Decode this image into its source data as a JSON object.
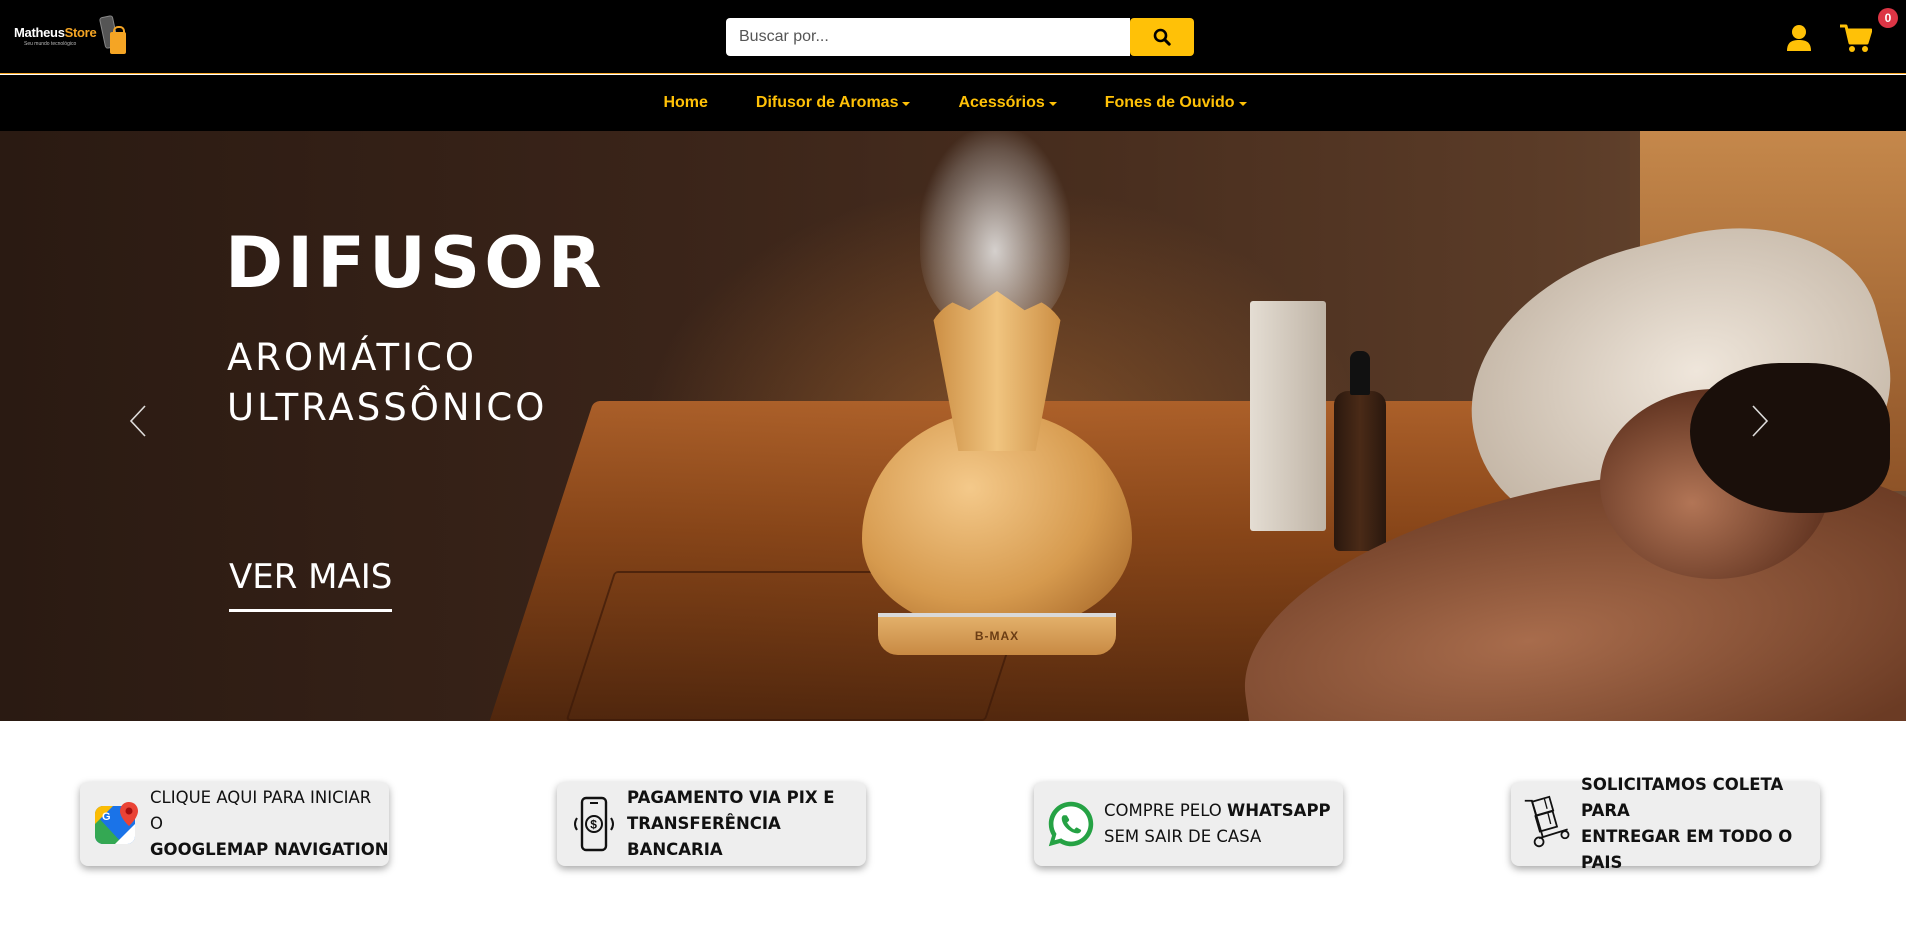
{
  "header": {
    "logo": {
      "name_part1": "Matheus",
      "name_part2": "Store",
      "tagline": "Seu mundo tecnológico"
    },
    "search": {
      "placeholder": "Buscar por...",
      "value": ""
    },
    "cart_count": "0",
    "accent_color": "#ffc107"
  },
  "nav": {
    "items": [
      {
        "label": "Home",
        "dropdown": false
      },
      {
        "label": "Difusor de Aromas",
        "dropdown": true
      },
      {
        "label": "Acessórios",
        "dropdown": true
      },
      {
        "label": "Fones de Ouvido",
        "dropdown": true
      }
    ]
  },
  "hero": {
    "title": "DIFUSOR",
    "subtitle": "AROMÁTICO ULTRASSÔNICO",
    "cta": "VER MAIS",
    "product_brand": "B-MAX"
  },
  "features": [
    {
      "icon": "google-maps-icon",
      "line1": "CLIQUE AQUI PARA INICIAR O",
      "line2": "GOOGLEMAP NAVIGATION"
    },
    {
      "icon": "pix-payment-icon",
      "line1": "PAGAMENTO VIA PIX E",
      "line2": "TRANSFERÊNCIA BANCARIA"
    },
    {
      "icon": "whatsapp-icon",
      "line1_a": "COMPRE PELO ",
      "line1_b": "WHATSAPP",
      "line2": "SEM SAIR DE CASA"
    },
    {
      "icon": "delivery-cart-icon",
      "line1": "SOLICITAMOS COLETA PARA",
      "line2": "ENTREGAR EM TODO O PAIS"
    }
  ]
}
